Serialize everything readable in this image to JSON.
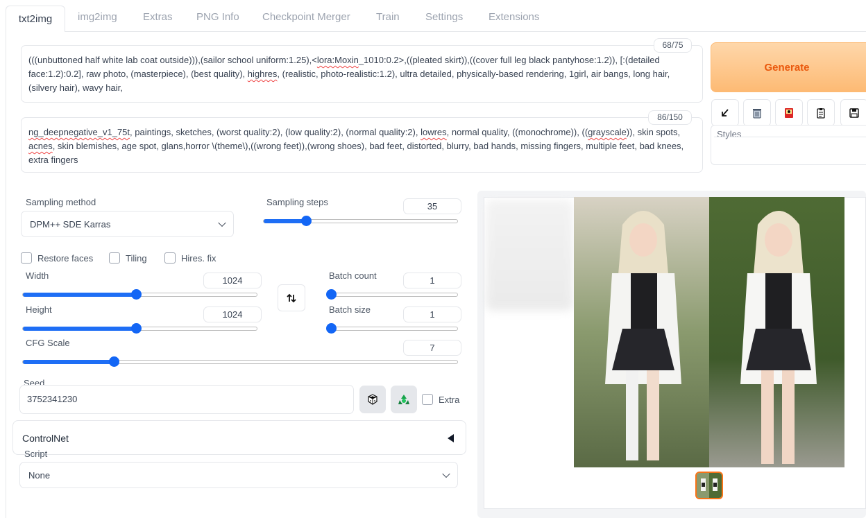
{
  "tabs": [
    "txt2img",
    "img2img",
    "Extras",
    "PNG Info",
    "Checkpoint Merger",
    "Train",
    "Settings",
    "Extensions"
  ],
  "prompt": {
    "counter": "68/75",
    "parts": [
      {
        "t": "(((unbuttoned half white lab coat outside))),(sailor school uniform:1.25),<",
        "s": false
      },
      {
        "t": "lora:Moxin",
        "s": true
      },
      {
        "t": "_1010:0.2>,((pleated skirt)),((cover full leg black pantyhose:1.2)), [:(detailed face:1.2):0.2], raw photo, (masterpiece), (best quality), ",
        "s": false
      },
      {
        "t": "highres",
        "s": true
      },
      {
        "t": ", (realistic, photo-realistic:1.2), ultra detailed, physically-based rendering, 1girl, air bangs, long hair, (silvery hair), wavy hair,",
        "s": false
      }
    ]
  },
  "negative_prompt": {
    "counter": "86/150",
    "parts": [
      {
        "t": "ng_deepnegative_v1_75t",
        "s": true
      },
      {
        "t": ", paintings, sketches, (worst quality:2), (low quality:2), (normal quality:2), ",
        "s": false
      },
      {
        "t": "lowres",
        "s": true
      },
      {
        "t": ", normal quality, ((monochrome)), ((",
        "s": false
      },
      {
        "t": "grayscale",
        "s": true
      },
      {
        "t": ")), skin spots, ",
        "s": false
      },
      {
        "t": "acnes",
        "s": true
      },
      {
        "t": ", skin blemishes, age spot, glans,horror \\(theme\\),((wrong feet)),(wrong shoes), bad feet, distorted, blurry, bad hands, missing fingers, multiple feet, bad knees, extra fingers",
        "s": false
      }
    ]
  },
  "generate_label": "Generate",
  "styles_label": "Styles",
  "toolbar_icons": [
    "arrow-down-left-icon",
    "trash-icon",
    "model-card-icon",
    "clipboard-icon",
    "save-icon"
  ],
  "sampling": {
    "method_label": "Sampling method",
    "method_value": "DPM++ SDE Karras",
    "steps_label": "Sampling steps",
    "steps_value": "35",
    "steps_fraction": 0.22
  },
  "checkboxes": {
    "restore_faces": "Restore faces",
    "tiling": "Tiling",
    "hires_fix": "Hires. fix"
  },
  "width": {
    "label": "Width",
    "value": "1024",
    "fraction": 0.485
  },
  "height": {
    "label": "Height",
    "value": "1024",
    "fraction": 0.485
  },
  "batch_count": {
    "label": "Batch count",
    "value": "1",
    "fraction": 0.0
  },
  "batch_size": {
    "label": "Batch size",
    "value": "1",
    "fraction": 0.0
  },
  "cfg": {
    "label": "CFG Scale",
    "value": "7",
    "fraction": 0.21
  },
  "seed": {
    "label": "Seed",
    "value": "3752341230",
    "extra_label": "Extra"
  },
  "controlnet_label": "ControlNet",
  "script": {
    "label": "Script",
    "value": "None"
  },
  "colors": {
    "accent": "#1366f5",
    "generate": "#ea580c",
    "thumb_border": "#f97316"
  }
}
